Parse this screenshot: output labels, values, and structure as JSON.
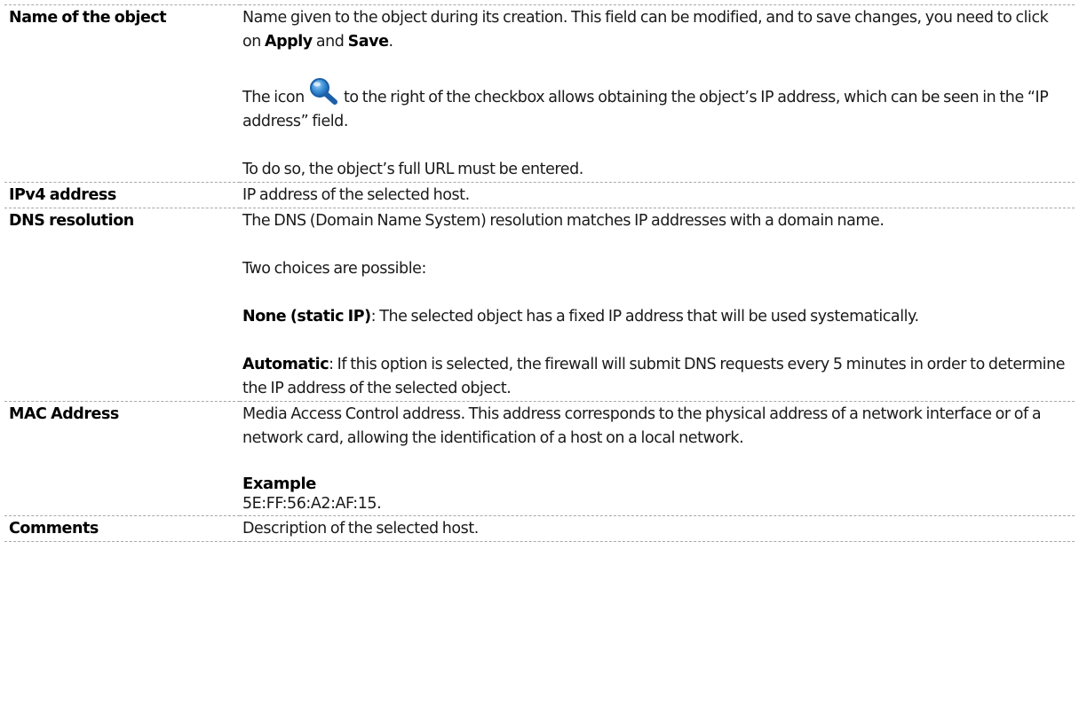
{
  "rows": {
    "name": {
      "term": "Name of the object",
      "p1_a": "Name given to the object during its creation. This field can be modified, and to save changes, you need to click on ",
      "p1_b": "Apply",
      "p1_c": " and ",
      "p1_d": "Save",
      "p1_e": ".",
      "p2_a": "The icon ",
      "p2_icon": "search-icon",
      "p2_b": " to the right of the checkbox allows obtaining the object’s IP address, which can be seen in the “IP address” field.",
      "p3": "To do so, the object’s full URL must be entered."
    },
    "ipv4": {
      "term": "IPv4 address",
      "desc": "IP address of the selected host."
    },
    "dns": {
      "term": "DNS resolution",
      "p1": "The DNS (Domain Name System) resolution matches IP addresses with a domain name.",
      "p2": "Two choices are possible:",
      "p3_label": "None (static IP)",
      "p3_text": ": The selected object has a fixed IP address that will be used systematically.",
      "p4_label": "Automatic",
      "p4_text": ": If this option is selected, the firewall will submit DNS requests every 5 minutes in order to determine the IP address of the selected object."
    },
    "mac": {
      "term": "MAC Address",
      "p1": "Media Access Control address. This address corresponds to the physical address of a network interface or of a network card, allowing the identification of a host on a local network.",
      "example_heading": "Example",
      "example_value": "5E:FF:56:A2:AF:15."
    },
    "comments": {
      "term": "Comments",
      "desc": "Description of the selected host."
    }
  },
  "colors": {
    "icon_blue": "#3a8fd6",
    "icon_dark": "#1c5fa8",
    "border": "#a8a8a8"
  }
}
